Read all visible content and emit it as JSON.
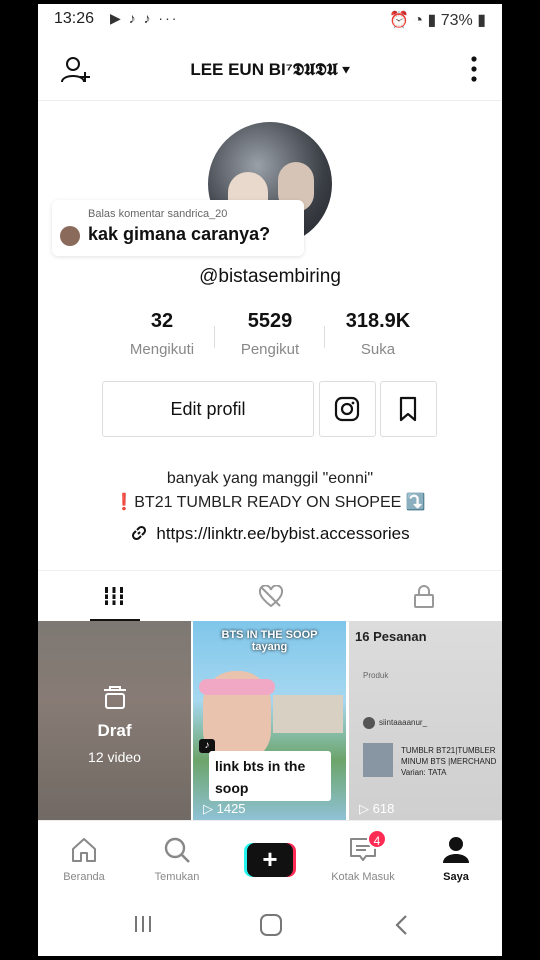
{
  "status_bar": {
    "time": "13:26",
    "battery": "73%"
  },
  "header": {
    "title": "LEE EUN BI⁷𝕯𝖀𝕯𝖀"
  },
  "comment_bubble": {
    "reply_to": "Balas komentar sandrica_20",
    "text": "kak gimana caranya?"
  },
  "profile": {
    "username": "@bistasembiring",
    "stats": [
      {
        "value": "32",
        "label": "Mengikuti"
      },
      {
        "value": "5529",
        "label": "Pengikut"
      },
      {
        "value": "318.9K",
        "label": "Suka"
      }
    ],
    "edit_label": "Edit profil",
    "bio_line1": "banyak yang manggil \"eonni\"",
    "bio_line2": "❗BT21 TUMBLR READY ON SHOPEE ⤵️",
    "link": "https://linktr.ee/bybist.accessories"
  },
  "videos": {
    "draft": {
      "label": "Draf",
      "count": "12 video"
    },
    "v2": {
      "caption_top": "BTS IN THE SOOP\ntayang",
      "sticker": "link bts in the soop",
      "views": "1425"
    },
    "v3": {
      "header": "16 Pesanan",
      "product_label": "Produk",
      "user": "siintaaaanur_",
      "desc": "TUMBLR BT21|TUMBLER\nMINUM BTS |MERCHAND\nVarian: TATA",
      "views": "618"
    }
  },
  "bottom_nav": {
    "items": [
      "Beranda",
      "Temukan",
      "Kotak Masuk",
      "Saya"
    ],
    "inbox_badge": "4"
  },
  "icons": [
    "add-user-icon",
    "more-icon",
    "instagram-icon",
    "bookmark-icon",
    "grid-icon",
    "liked-icon",
    "lock-icon",
    "home-icon",
    "search-icon",
    "inbox-icon",
    "profile-icon"
  ]
}
